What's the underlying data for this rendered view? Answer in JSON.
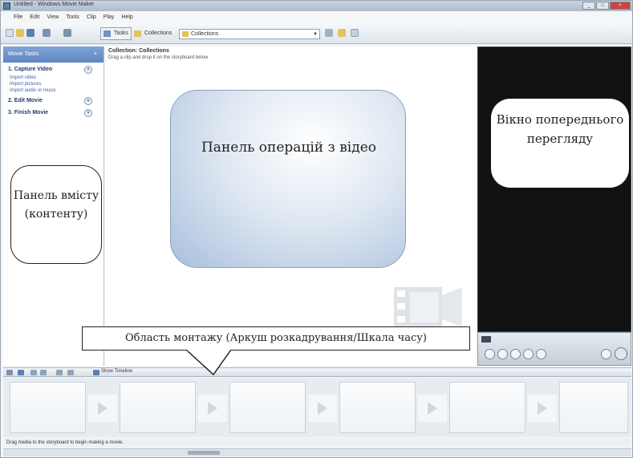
{
  "window": {
    "title": "Untitled - Windows Movie Maker",
    "controls": {
      "minimize": "_",
      "maximize": "□",
      "close": "×"
    }
  },
  "menu": [
    "File",
    "Edit",
    "View",
    "Tools",
    "Clip",
    "Play",
    "Help"
  ],
  "toolbar": {
    "tasks_label": "Tasks",
    "collections_label": "Collections",
    "collection_combo_value": "Collections"
  },
  "task_pane": {
    "header": "Movie Tasks",
    "sections": [
      {
        "label": "1. Capture Video",
        "links": [
          "Import video",
          "Import pictures",
          "Import audio or music"
        ]
      },
      {
        "label": "2. Edit Movie",
        "links": []
      },
      {
        "label": "3. Finish Movie",
        "links": []
      }
    ]
  },
  "collection": {
    "title": "Collection: Collections",
    "subtitle": "Drag a clip and drop it on the storyboard below"
  },
  "storyboard": {
    "toggle_label": "Show Timeline",
    "status_text": "Drag media to the storyboard to begin making a movie."
  },
  "annotations": {
    "operations_panel": "Панель операцій з відео",
    "content_panel": "Панель вмісту (контенту)",
    "preview_window": "Вікно попереднього перегляду",
    "timeline_area": "Область монтажу (Аркуш розкадрування/Шкала часу)"
  },
  "colors": {
    "task_header": "#6f95cc",
    "preview_bg": "#121212",
    "callout_gradient_edge": "#a9bfdd"
  }
}
